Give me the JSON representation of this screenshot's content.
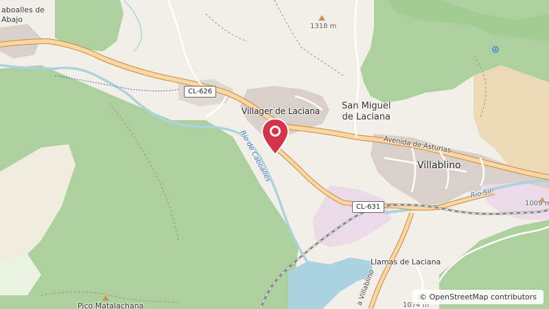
{
  "places": {
    "cabo_abajo": "aboalles de\nAbajo",
    "villager": "Villager de Laciana",
    "san_miguel": "San Miguel\nde Laciana",
    "villablino": "Villablino",
    "llamas": "Llamas de Laciana",
    "pico": "Pico Matalachana"
  },
  "streets": {
    "avenida": "Avenida de Asturias",
    "villablino_road": "a Villablino"
  },
  "roads": {
    "cl626": "CL-626",
    "cl631": "CL-631"
  },
  "rivers": {
    "caboalles": "Río de Caboalles",
    "sil": "Río Sil"
  },
  "peaks": {
    "p1318": "1318 m",
    "p1009": "1009 m",
    "p1074": "1074 m"
  },
  "attribution": {
    "symbol": "©",
    "text": "OpenStreetMap contributors"
  },
  "marker": {
    "icon": "map-pin-icon",
    "color": "#d6334a"
  }
}
